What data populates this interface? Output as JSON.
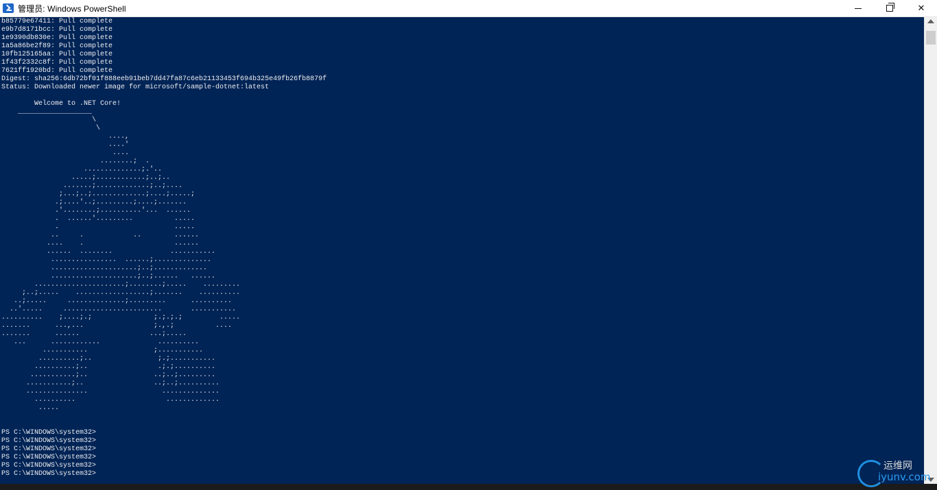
{
  "window": {
    "title": "管理员: Windows PowerShell",
    "icon": "powershell-icon",
    "controls": {
      "minimize": "minimize-icon",
      "maximize": "restore-icon",
      "close_glyph": "✕"
    }
  },
  "console": {
    "background": "#012456",
    "foreground": "#eeedf0",
    "lines": [
      "b85779e67411: Pull complete",
      "e9b7d8171bcc: Pull complete",
      "1e9390db830e: Pull complete",
      "1a5a86be2f89: Pull complete",
      "10fb125165aa: Pull complete",
      "1f43f2332c8f: Pull complete",
      "7621ff1920bd: Pull complete",
      "Digest: sha256:6db72bf01f888eeb91beb7dd47fa87c6eb21133453f694b325e49fb26fb8879f",
      "Status: Downloaded newer image for microsoft/sample-dotnet:latest",
      "",
      "        Welcome to .NET Core!",
      "    __________________",
      "                      \\",
      "                       \\",
      "                          ....,",
      "                          ....'",
      "                           ....",
      "                        ........;  .",
      "                    ..............;.'..",
      "                 .....;............;..;..",
      "               .......;.............;..;....",
      "              ;...;..;.............;....;.....;",
      "             .;....'..;.........;....;.......",
      "             .'........;..........'...  ......",
      "             .  ......'.........          .....",
      "             .                            .....",
      "            ..     .            ..        ......",
      "           ....    .                      ......",
      "           ......  ........              ...........",
      "            ................  ......;..............",
      "            .....................;..;.............",
      "            .....................;..;......   ......",
      "        ......................;........;.....    .........",
      "     ;..;.....    ..................;.......    ..........",
      "   ..;.....     ..............;.........      ..........",
      "  ..'.....     ........................       ...........",
      "..........    ;....;.;               ;.;.;.;         .....",
      ".......      ...,...                 ;.,.;          ....",
      ".......      ......                 ...;.....",
      "   ...      ............              ..........",
      "          ...........                ;...........",
      "         ..........;..                ;.;...........",
      "        ..........;..                 .;.;..........",
      "       ...........;..                ..;..;.........",
      "      ...........;..                 ..;..;..........",
      "      ...............                  ..............",
      "        ..........                      .............",
      "         .....",
      "",
      "",
      "PS C:\\WINDOWS\\system32>",
      "PS C:\\WINDOWS\\system32>",
      "PS C:\\WINDOWS\\system32>",
      "PS C:\\WINDOWS\\system32>",
      "PS C:\\WINDOWS\\system32>",
      "PS C:\\WINDOWS\\system32>"
    ]
  },
  "watermark": {
    "top_text": "运维网",
    "bottom_text": "iyunv.com",
    "accent": "#1f8fe0"
  }
}
